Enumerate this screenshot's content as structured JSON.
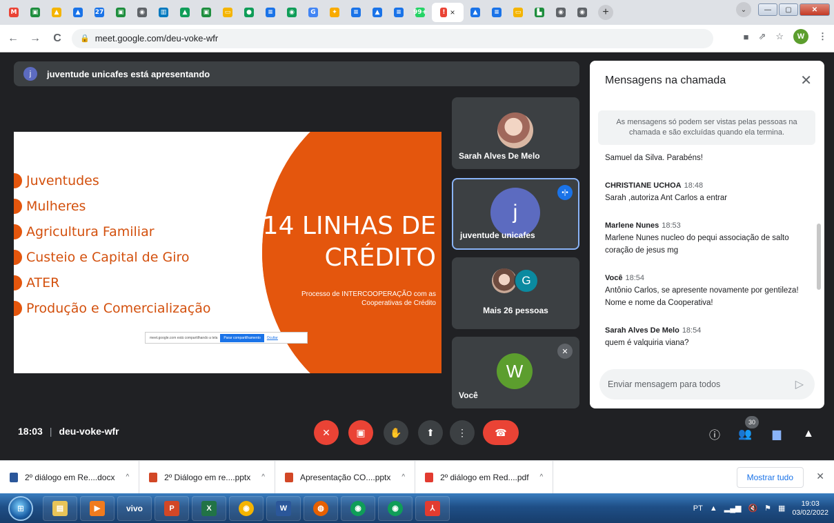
{
  "browser": {
    "tabs": [
      {
        "icon": "gmail-icon",
        "color": "#ea4335",
        "glyph": "M"
      },
      {
        "icon": "classroom-icon",
        "color": "#1e8e3e",
        "glyph": "▣"
      },
      {
        "icon": "drive-icon",
        "color": "#f4b400",
        "glyph": "▲"
      },
      {
        "icon": "drive-icon",
        "color": "#1a73e8",
        "glyph": "▲"
      },
      {
        "icon": "calendar-icon",
        "color": "#1a73e8",
        "glyph": "27"
      },
      {
        "icon": "classroom-icon",
        "color": "#1e8e3e",
        "glyph": "▣"
      },
      {
        "icon": "chrome-icon",
        "color": "#5f6368",
        "glyph": "◉"
      },
      {
        "icon": "trello-icon",
        "color": "#0079bf",
        "glyph": "▥"
      },
      {
        "icon": "drive-icon",
        "color": "#0f9d58",
        "glyph": "▲"
      },
      {
        "icon": "classroom-icon",
        "color": "#1e8e3e",
        "glyph": "▣"
      },
      {
        "icon": "slides-icon",
        "color": "#f4b400",
        "glyph": "▭"
      },
      {
        "icon": "meet-circle-icon",
        "color": "#0f9d58",
        "glyph": "●"
      },
      {
        "icon": "docs-icon",
        "color": "#1a73e8",
        "glyph": "≡"
      },
      {
        "icon": "chrome-green-icon",
        "color": "#0f9d58",
        "glyph": "◉"
      },
      {
        "icon": "google-icon",
        "color": "#4285f4",
        "glyph": "G"
      },
      {
        "icon": "bulb-icon",
        "color": "#f9ab00",
        "glyph": "✦"
      },
      {
        "icon": "docs-icon",
        "color": "#1a73e8",
        "glyph": "≡"
      },
      {
        "icon": "drive-icon",
        "color": "#1a73e8",
        "glyph": "▲"
      },
      {
        "icon": "docs-icon",
        "color": "#1a73e8",
        "glyph": "≡"
      },
      {
        "icon": "whatsapp-icon",
        "color": "#25d366",
        "glyph": "99+"
      }
    ],
    "active_tab": {
      "icon": "meet-icon",
      "color": "#ea4335",
      "glyph": "!",
      "close": "×"
    },
    "tabs_after": [
      {
        "icon": "drive-icon",
        "color": "#1a73e8",
        "glyph": "▲"
      },
      {
        "icon": "docs-icon",
        "color": "#1a73e8",
        "glyph": "≡"
      },
      {
        "icon": "slides-icon",
        "color": "#f4b400",
        "glyph": "▭"
      },
      {
        "icon": "sites-icon",
        "color": "#1e8e3e",
        "glyph": "▙"
      },
      {
        "icon": "chrome-icon",
        "color": "#5f6368",
        "glyph": "◉"
      },
      {
        "icon": "chrome-icon",
        "color": "#5f6368",
        "glyph": "◉"
      }
    ],
    "new_tab": "+",
    "url": "meet.google.com/deu-voke-wfr",
    "profile_letter": "W"
  },
  "meet": {
    "presenter_initial": "j",
    "presenter_text": "juventude unicafes está apresentando",
    "slide": {
      "bullets": [
        "Juventudes",
        "Mulheres",
        "Agricultura Familiar",
        "Custeio e Capital de Giro",
        "ATER",
        "Produção e Comercialização"
      ],
      "title_line1": "14 LINHAS DE",
      "title_line2": "CRÉDITO",
      "subtitle_line1": "Processo de INTERCOOPERAÇÃO com as",
      "subtitle_line2": "Cooperativas de Crédito",
      "share_notice": "meet.google.com está compartilhando a tela",
      "stop_sharing": "Parar compartilhamento",
      "hide": "Ocultar"
    },
    "tiles": [
      {
        "name": "Sarah Alves De Melo"
      },
      {
        "name": "juventude unicafes",
        "initial": "j"
      },
      {
        "name": "Mais 26 pessoas",
        "initial": "G"
      },
      {
        "name": "Você",
        "initial": "W"
      }
    ],
    "chat": {
      "title": "Mensagens na chamada",
      "notice": "As mensagens só podem ser vistas pelas pessoas na chamada e são excluídas quando ela termina.",
      "messages": [
        {
          "author": "",
          "time": "",
          "text": "Samuel da Silva. Parabéns!"
        },
        {
          "author": "CHRISTIANE UCHOA",
          "time": "18:48",
          "text": "Sarah ,autoriza Ant Carlos a entrar"
        },
        {
          "author": "Marlene Nunes",
          "time": "18:53",
          "text": "Marlene Nunes  nucleo do pequi associação de salto coração de jesus mg"
        },
        {
          "author": "Você",
          "time": "18:54",
          "text": "Antônio Carlos, se apresente novamente por gentileza! Nome e nome da Cooperativa!"
        },
        {
          "author": "Sarah Alves De Melo",
          "time": "18:54",
          "text": "quem é valquiria viana?"
        }
      ],
      "input_placeholder": "Enviar mensagem para todos"
    },
    "time": "18:03",
    "meeting_code": "deu-voke-wfr",
    "participants_count": "30"
  },
  "downloads": {
    "items": [
      {
        "name": "2º diálogo em Re....docx",
        "color": "#2b579a"
      },
      {
        "name": "2º Diálogo em re....pptx",
        "color": "#d24726"
      },
      {
        "name": "Apresentação CO....pptx",
        "color": "#d24726"
      },
      {
        "name": "2º diálogo em Red....pdf",
        "color": "#e23b30"
      }
    ],
    "show_all": "Mostrar tudo"
  },
  "taskbar": {
    "vivo": "vivo",
    "language": "PT",
    "time": "19:03",
    "date": "03/02/2022"
  }
}
